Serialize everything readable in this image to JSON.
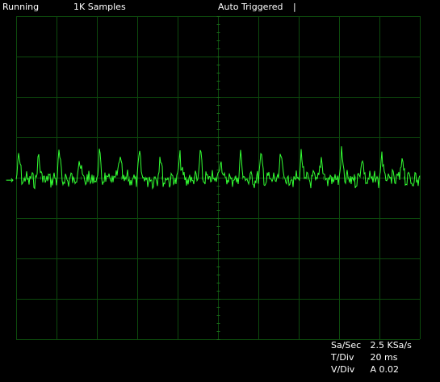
{
  "status_bar": {
    "run_state": "Running",
    "sample_count": "1K Samples",
    "trigger_mode": "Auto Triggered",
    "cursor_marker": "|"
  },
  "scope": {
    "grid_divisions": {
      "horizontal": 10,
      "vertical": 8
    },
    "channel_marker": "→",
    "colors": {
      "background": "#000000",
      "grid": "#0d4a0d",
      "grid_center": "#1a6b1a",
      "trace": "#33ff33",
      "text": "#ffffff"
    }
  },
  "readouts": {
    "sample_rate_label": "Sa/Sec",
    "sample_rate_value": "2.5 KSa/s",
    "time_div_label": "T/Div",
    "time_div_value": "20 ms",
    "volt_div_label": "V/Div",
    "volt_div_value": "A 0.02"
  }
}
